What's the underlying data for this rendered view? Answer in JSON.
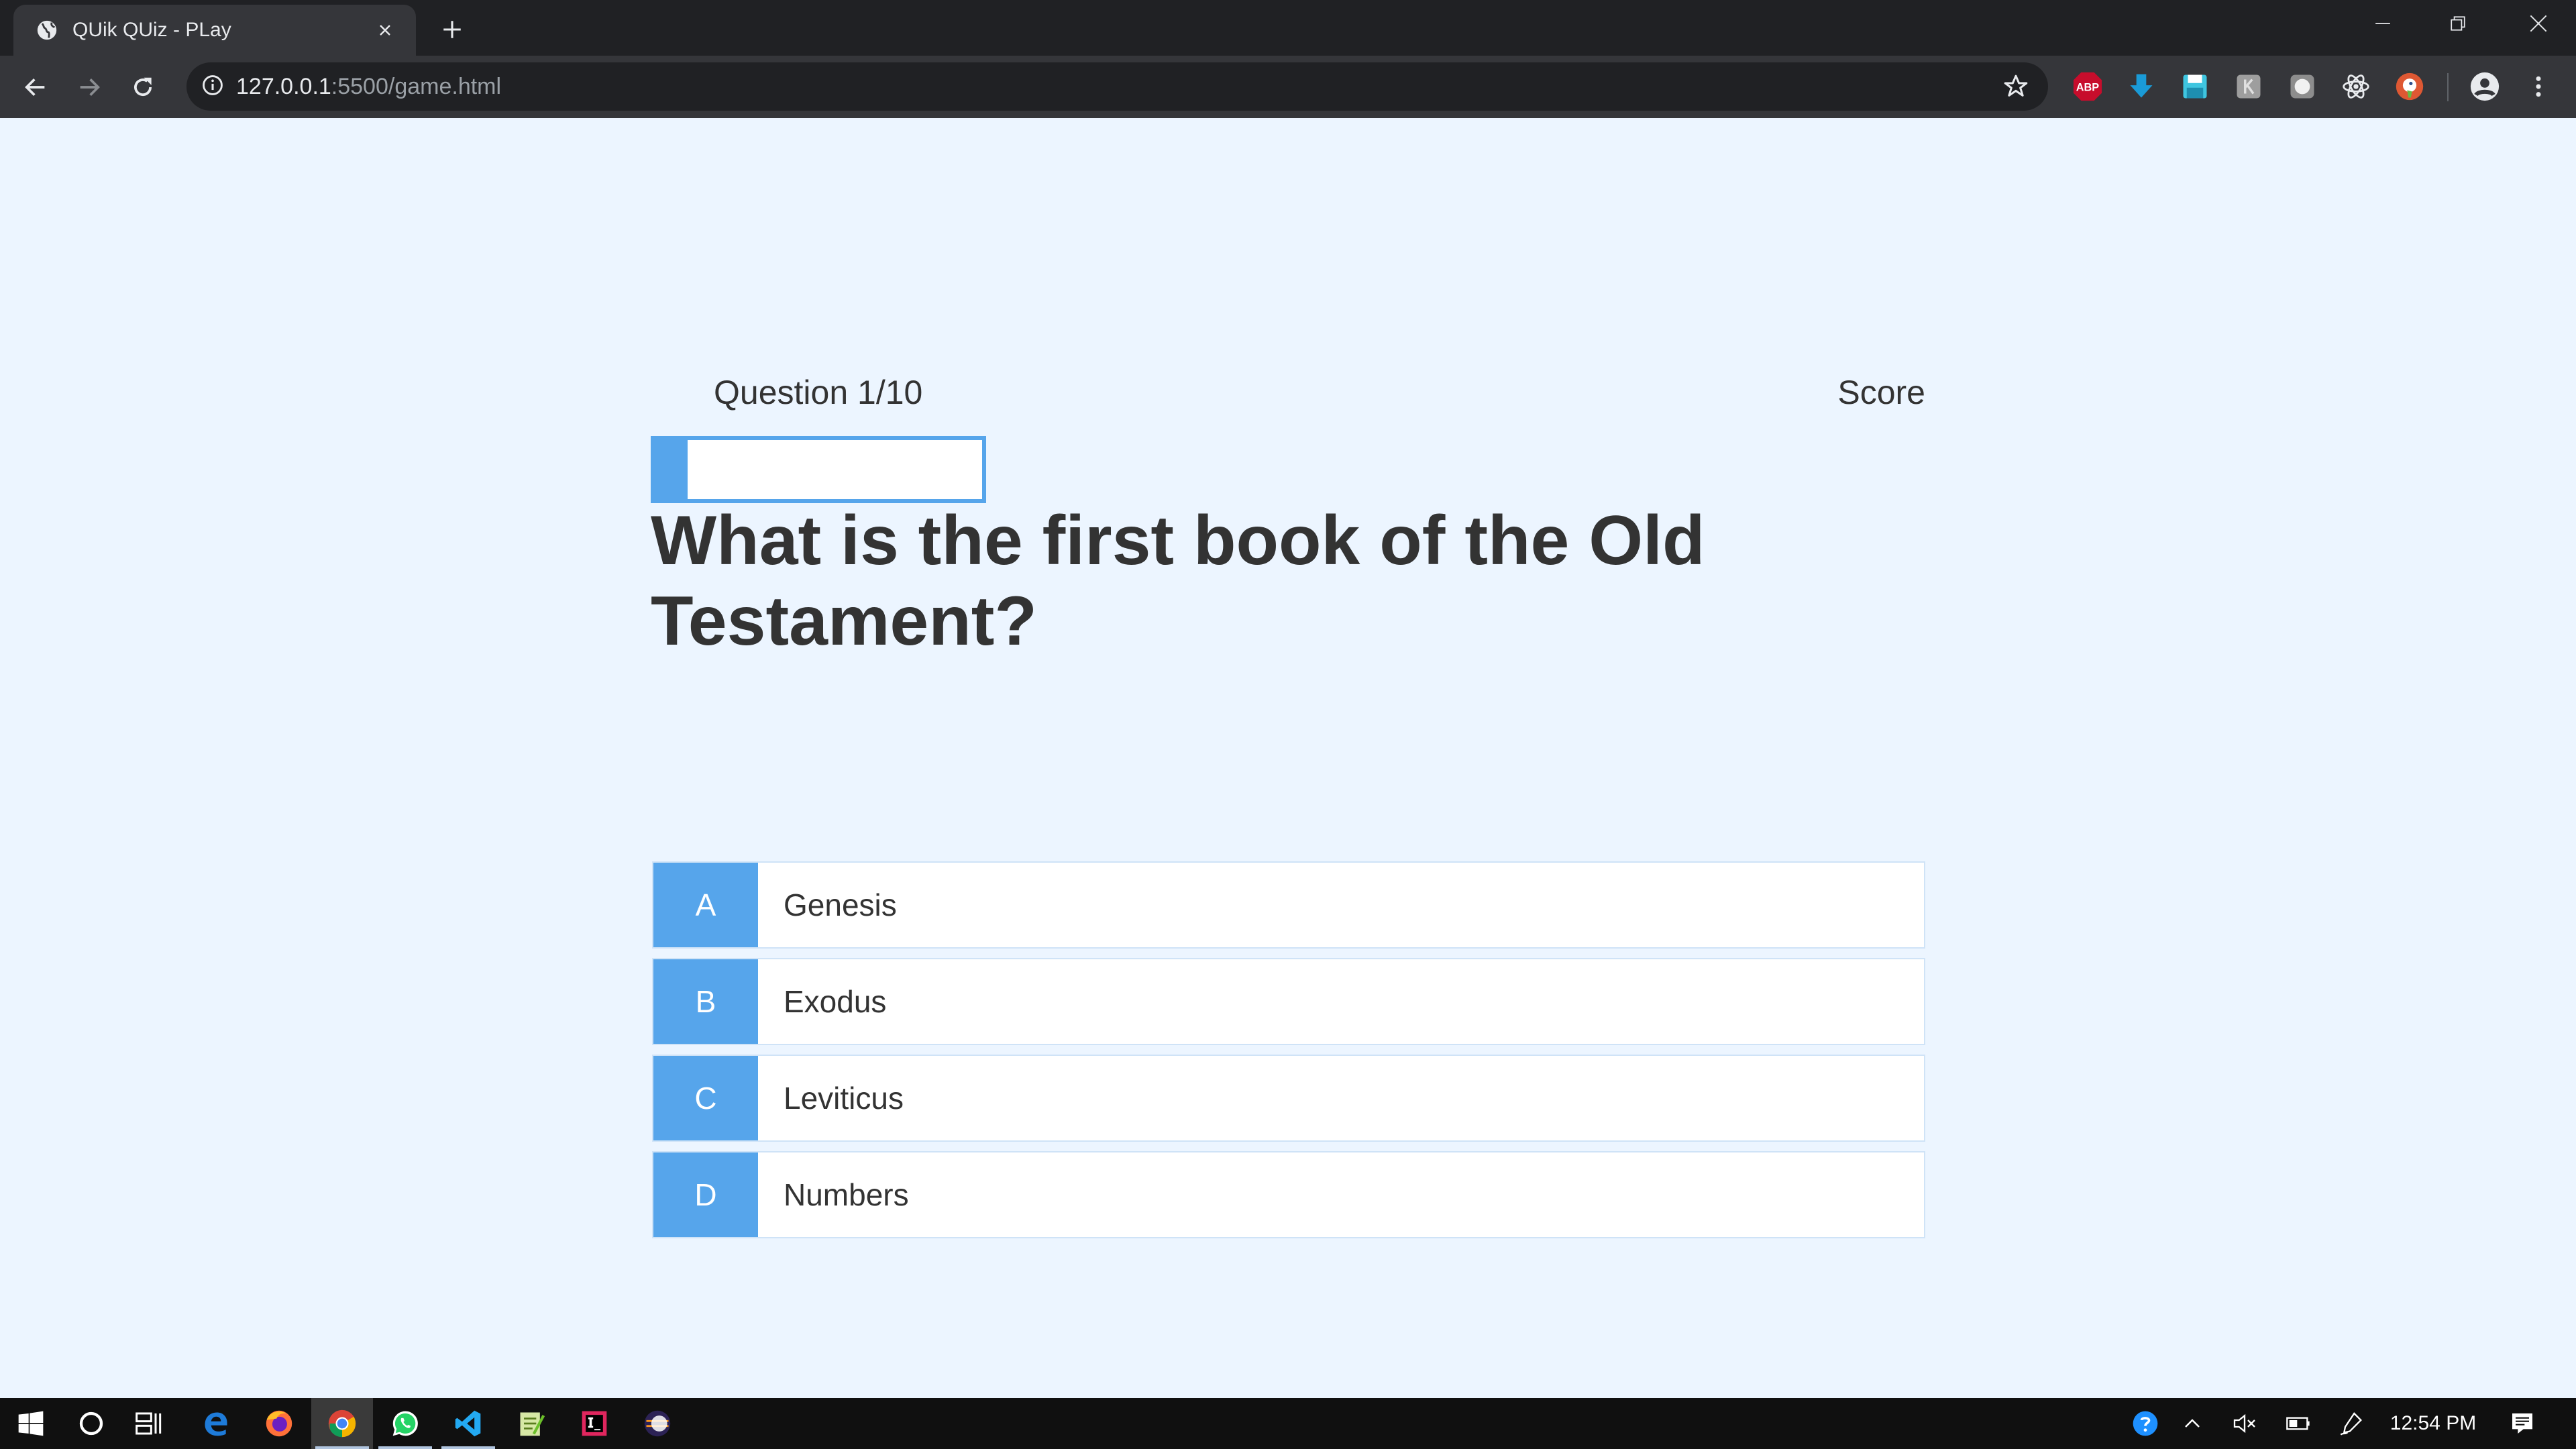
{
  "browser": {
    "tab_title": "QUik QUiz - PLay",
    "url_host": "127.0.0.1",
    "url_rest": ":5500/game.html"
  },
  "hud": {
    "question_counter": "Question 1/10",
    "score_label": "Score",
    "progress": 0.1
  },
  "question": "What is the first book of the Old Testament?",
  "choices": [
    {
      "prefix": "A",
      "text": "Genesis"
    },
    {
      "prefix": "B",
      "text": "Exodus"
    },
    {
      "prefix": "C",
      "text": "Leviticus"
    },
    {
      "prefix": "D",
      "text": "Numbers"
    }
  ],
  "extensions": {
    "abp_label": "ABP"
  },
  "taskbar": {
    "clock": "12:54 PM"
  },
  "colors": {
    "accent": "#56a5eb",
    "page_bg": "#ecf5ff"
  }
}
